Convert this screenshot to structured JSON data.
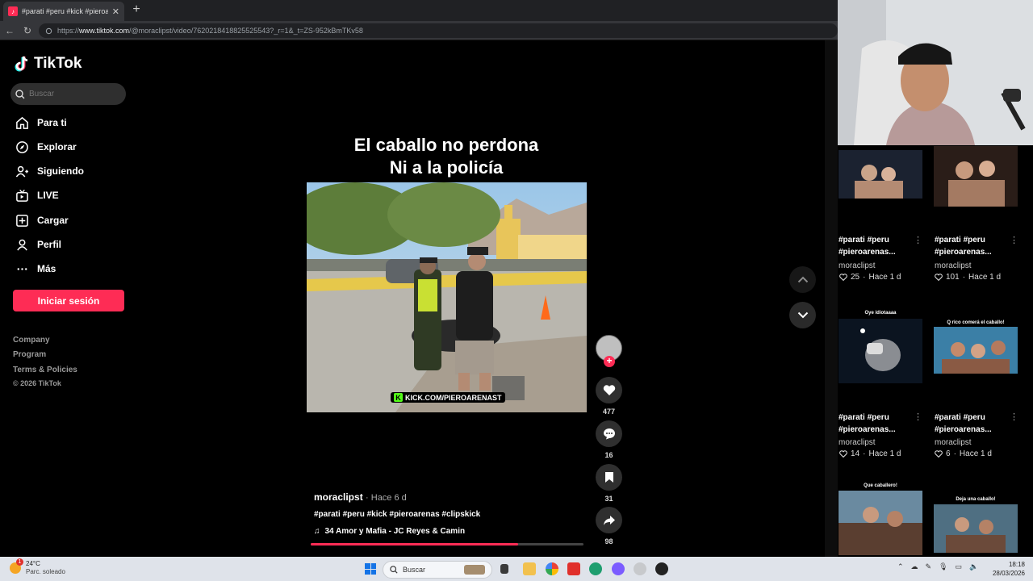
{
  "browser": {
    "tab_title": "#parati #peru #kick #pieroarenas",
    "url_prefix": "https://",
    "url_domain": "www.tiktok.com",
    "url_path": "/@moraclipst/video/7620218418825525543?_r=1&_t=ZS-952kBmTKv58"
  },
  "sidebar": {
    "brand": "TikTok",
    "search_placeholder": "Buscar",
    "nav": [
      {
        "label": "Para ti",
        "icon": "home-icon"
      },
      {
        "label": "Explorar",
        "icon": "compass-icon"
      },
      {
        "label": "Siguiendo",
        "icon": "following-icon"
      },
      {
        "label": "LIVE",
        "icon": "live-icon"
      },
      {
        "label": "Cargar",
        "icon": "upload-icon"
      },
      {
        "label": "Perfil",
        "icon": "profile-icon"
      },
      {
        "label": "Más",
        "icon": "more-icon"
      }
    ],
    "login_label": "Iniciar sesión",
    "footer": [
      "Company",
      "Program",
      "Terms & Policies",
      "© 2026 TikTok"
    ]
  },
  "video": {
    "caption_line1": "El caballo no perdona",
    "caption_line2": "Ni a la policía",
    "watermark": "KICK.COM/PIEROARENAST",
    "author": "moraclipst",
    "posted": "· Hace 6 d",
    "hashtags": "#parati #peru #kick #pieroarenas #clipskick",
    "music": "34 Amor y Mafia - JC Reyes & Camin",
    "likes": "477",
    "comments": "16",
    "saves": "31",
    "shares": "98",
    "progress": 0.76
  },
  "related": [
    {
      "title_line1": "#parati #peru",
      "title_line2": "#pieroarenas...",
      "user": "moraclipst",
      "likes": "25",
      "age": "Hace 1 d",
      "thumb_caption": ""
    },
    {
      "title_line1": "#parati #peru",
      "title_line2": "#pieroarenas...",
      "user": "moraclipst",
      "likes": "101",
      "age": "Hace 1 d",
      "thumb_caption": ""
    },
    {
      "title_line1": "#parati #peru",
      "title_line2": "#pieroarenas...",
      "user": "moraclipst",
      "likes": "14",
      "age": "Hace 1 d",
      "thumb_caption": "Oye idiotaaaa"
    },
    {
      "title_line1": "#parati #peru",
      "title_line2": "#pieroarenas...",
      "user": "moraclipst",
      "likes": "6",
      "age": "Hace 1 d",
      "thumb_caption": "Q rico comerá el caballo!"
    },
    {
      "thumb_caption": "Que caballero!"
    },
    {
      "thumb_caption": "Deja una caballo!"
    }
  ],
  "taskbar": {
    "temperature": "24°C",
    "weather": "Parc. soleado",
    "weather_badge": "1",
    "search_placeholder": "Buscar",
    "time": "18:18",
    "date": "28/03/2026"
  },
  "colors": {
    "accent": "#fe2c55",
    "kick": "#53fc18"
  }
}
